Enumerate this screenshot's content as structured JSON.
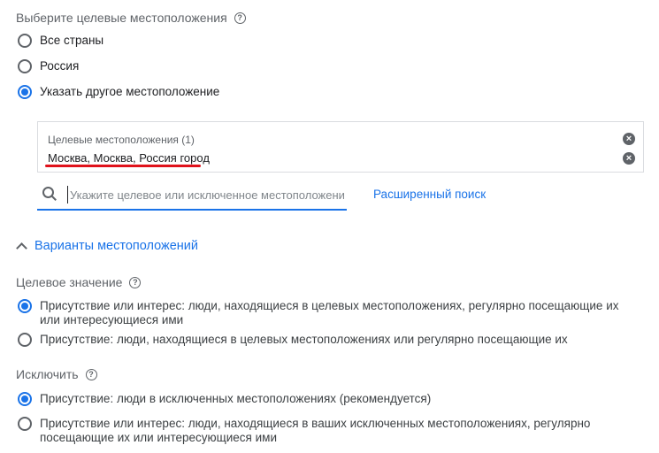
{
  "targeting": {
    "title": "Выберите целевые местоположения",
    "options": [
      {
        "label": "Все страны",
        "checked": false
      },
      {
        "label": "Россия",
        "checked": false
      },
      {
        "label": "Указать другое местоположение",
        "checked": true
      }
    ]
  },
  "locations_box": {
    "header": "Целевые местоположения (1)",
    "item": "Москва, Москва, Россия город"
  },
  "search": {
    "placeholder": "Укажите целевое или исключенное местоположение",
    "advanced_link": "Расширенный поиск"
  },
  "location_options": {
    "toggle_label": "Варианты местоположений",
    "target": {
      "title": "Целевое значение",
      "options": [
        {
          "label": "Присутствие или интерес: люди, находящиеся в целевых местоположениях, регулярно посещающие их или интересующиеся ими",
          "checked": true
        },
        {
          "label": "Присутствие: люди, находящиеся в целевых местоположениях или регулярно посещающие их",
          "checked": false
        }
      ]
    },
    "exclude": {
      "title": "Исключить",
      "options": [
        {
          "label": "Присутствие: люди в исключенных местоположениях (рекомендуется)",
          "checked": true
        },
        {
          "label": "Присутствие или интерес: люди, находящиеся в ваших исключенных местоположениях, регулярно посещающие их или интересующиеся ими",
          "checked": false
        }
      ]
    }
  },
  "colors": {
    "accent": "#1a73e8",
    "underline": "#e0121b"
  }
}
